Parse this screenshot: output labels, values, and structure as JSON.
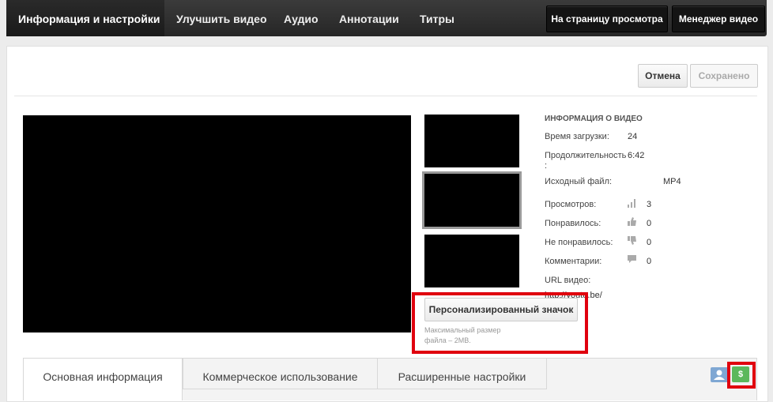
{
  "topnav": {
    "tabs": [
      "Информация и настройки",
      "Улучшить видео",
      "Аудио",
      "Аннотации",
      "Титры"
    ],
    "watch_page_button": "На страницу просмотра",
    "video_manager_button": "Менеджер видео"
  },
  "actions": {
    "cancel": "Отмена",
    "saved": "Сохранено"
  },
  "thumbnail": {
    "custom_button": "Персонализированный значок",
    "hint_line1": "Максимальный размер",
    "hint_line2": "файла – 2MB."
  },
  "info": {
    "title": "ИНФОРМАЦИЯ О ВИДЕО",
    "upload_time_label": "Время загрузки:",
    "upload_time_value": "24",
    "duration_label": "Продолжительность",
    "duration_colon": ":",
    "duration_value": "6:42",
    "source_label": "Исходный файл:",
    "source_value": "MP4",
    "views_label": "Просмотров:",
    "views_value": "3",
    "likes_label": "Понравилось:",
    "likes_value": "0",
    "dislikes_label": "Не понравилось:",
    "dislikes_value": "0",
    "comments_label": "Комментарии:",
    "comments_value": "0",
    "url_label": "URL видео:",
    "url_value": "http://youtu.be/"
  },
  "bottom_tabs": [
    "Основная информация",
    "Коммерческое использование",
    "Расширенные настройки"
  ],
  "icons": {
    "user": "user-icon",
    "money": "dollar-icon"
  },
  "colors": {
    "highlight": "#e0000e",
    "money_green": "#5cb85c",
    "user_blue": "#7fa7d3"
  }
}
